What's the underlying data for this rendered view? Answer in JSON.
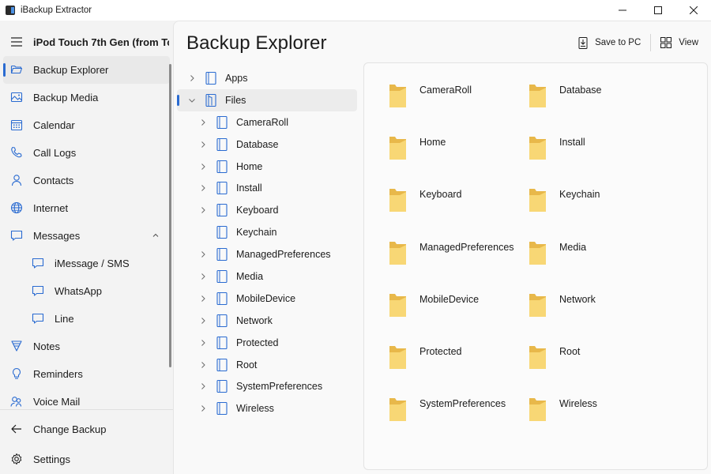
{
  "window": {
    "title": "iBackup Extractor"
  },
  "sidebar": {
    "device_name": "iPod Touch 7th Gen (from To...",
    "items": [
      {
        "label": "Backup Explorer",
        "icon": "folder-open-icon",
        "selected": true
      },
      {
        "label": "Backup Media",
        "icon": "image-icon"
      },
      {
        "label": "Calendar",
        "icon": "calendar-icon"
      },
      {
        "label": "Call Logs",
        "icon": "phone-icon"
      },
      {
        "label": "Contacts",
        "icon": "person-icon"
      },
      {
        "label": "Internet",
        "icon": "globe-icon"
      },
      {
        "label": "Messages",
        "icon": "chat-icon",
        "expanded": true
      },
      {
        "label": "iMessage / SMS",
        "icon": "chat-icon",
        "sub": true
      },
      {
        "label": "WhatsApp",
        "icon": "chat-icon",
        "sub": true
      },
      {
        "label": "Line",
        "icon": "chat-icon",
        "sub": true
      },
      {
        "label": "Notes",
        "icon": "notes-icon"
      },
      {
        "label": "Reminders",
        "icon": "lightbulb-icon"
      },
      {
        "label": "Voice Mail",
        "icon": "voicemail-icon"
      }
    ],
    "change_backup": "Change Backup",
    "settings": "Settings"
  },
  "main": {
    "title": "Backup Explorer",
    "save_label": "Save to PC",
    "view_label": "View"
  },
  "tree": [
    {
      "label": "Apps",
      "level": 0,
      "expanded": false
    },
    {
      "label": "Files",
      "level": 0,
      "expanded": true,
      "selected": true
    },
    {
      "label": "CameraRoll",
      "level": 1
    },
    {
      "label": "Database",
      "level": 1
    },
    {
      "label": "Home",
      "level": 1
    },
    {
      "label": "Install",
      "level": 1
    },
    {
      "label": "Keyboard",
      "level": 1
    },
    {
      "label": "Keychain",
      "level": 1,
      "no_chevron": true
    },
    {
      "label": "ManagedPreferences",
      "level": 1
    },
    {
      "label": "Media",
      "level": 1
    },
    {
      "label": "MobileDevice",
      "level": 1
    },
    {
      "label": "Network",
      "level": 1
    },
    {
      "label": "Protected",
      "level": 1
    },
    {
      "label": "Root",
      "level": 1
    },
    {
      "label": "SystemPreferences",
      "level": 1
    },
    {
      "label": "Wireless",
      "level": 1
    }
  ],
  "folders": [
    "CameraRoll",
    "Database",
    "Home",
    "Install",
    "Keyboard",
    "Keychain",
    "ManagedPreferences",
    "Media",
    "MobileDevice",
    "Network",
    "Protected",
    "Root",
    "SystemPreferences",
    "Wireless"
  ],
  "colors": {
    "accent": "#2a6bd1",
    "folder": "#f8d775",
    "folder_dark": "#e8b84a"
  }
}
